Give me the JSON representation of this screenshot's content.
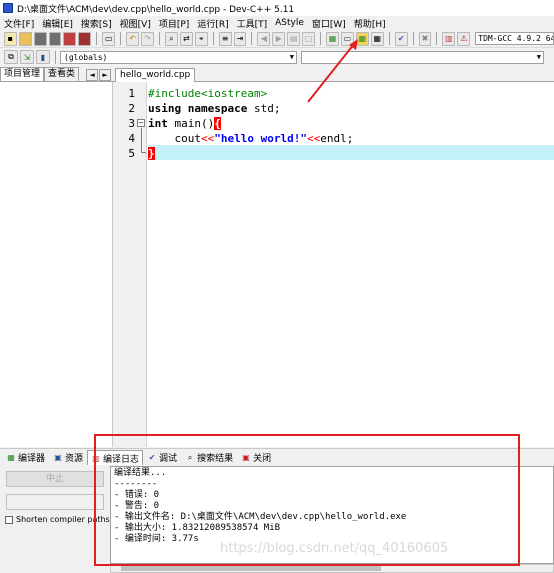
{
  "window": {
    "title": "D:\\桌面文件\\ACM\\dev\\dev.cpp\\hello_world.cpp - Dev-C++ 5.11"
  },
  "menu": [
    "文件[F]",
    "编辑[E]",
    "搜索[S]",
    "视图[V]",
    "项目[P]",
    "运行[R]",
    "工具[T]",
    "AStyle",
    "窗口[W]",
    "帮助[H]"
  ],
  "toolbar": {
    "compiler": "TDM-GCC 4.9.2 64-"
  },
  "toolbar2": {
    "scope": "(globals)"
  },
  "left_panel": {
    "tabs": [
      "项目管理",
      "查看类"
    ],
    "nav_prev": "◄",
    "nav_next": "►"
  },
  "editor": {
    "file_tab": "hello_world.cpp",
    "line_numbers": [
      "1",
      "2",
      "3",
      "4",
      "5"
    ],
    "code": {
      "l1": "#include<iostream>",
      "l2_kw": "using namespace",
      "l2_rest": " std;",
      "l3_kw": "int",
      "l3_rest": " main()",
      "l3_brace": "{",
      "l4_indent": "    cout",
      "l4_op1": "<<",
      "l4_str": "\"hello world!\"",
      "l4_op2": "<<",
      "l4_rest": "endl;",
      "l5": "}"
    }
  },
  "bottom_tabs": [
    "编译器",
    "资源",
    "编译日志",
    "调试",
    "搜索结果",
    "关闭"
  ],
  "bottom_left": {
    "stop": "中止",
    "shorten": "Shorten compiler paths"
  },
  "log": {
    "lines": [
      "编译结果...",
      "--------",
      "- 错误: 0",
      "- 警告: 0",
      "- 输出文件名: D:\\桌面文件\\ACM\\dev\\dev.cpp\\hello_world.exe",
      "- 输出大小: 1.83212089538574 MiB",
      "- 编译时间: 3.77s"
    ]
  },
  "watermark": "https://blog.csdn.net/qq_40160605"
}
